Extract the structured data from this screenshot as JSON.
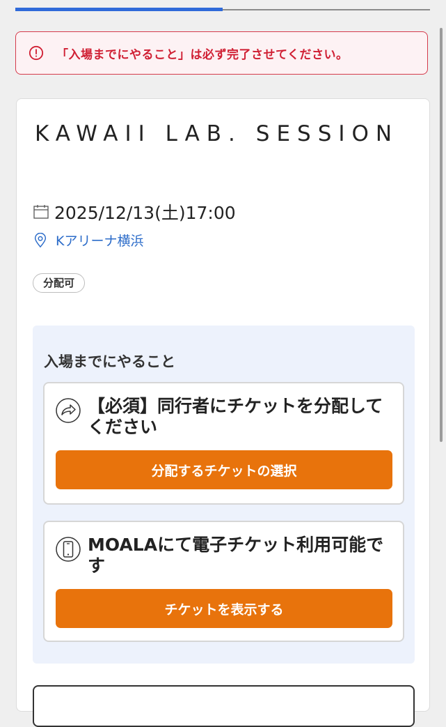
{
  "progress": {
    "fraction": 0.5
  },
  "alert": {
    "text": "「入場までにやること」は必ず完了させてください。",
    "icon": "exclamation-circle-icon",
    "color": "#d01f33"
  },
  "event": {
    "title": "KAWAII LAB. SESSION",
    "date": "2025/12/13(土)17:00",
    "venue": "Kアリーナ横浜",
    "badge": "分配可"
  },
  "todo": {
    "heading": "入場までにやること",
    "tasks": [
      {
        "icon": "share-arrow-icon",
        "text": "【必須】同行者にチケットを分配してください",
        "button": "分配するチケットの選択"
      },
      {
        "icon": "smartphone-icon",
        "text": "MOALAにて電子チケット利用可能です",
        "button": "チケットを表示する"
      }
    ]
  },
  "colors": {
    "accent": "#e8730c",
    "link": "#2c6cc9",
    "progress": "#2f6ad9",
    "panel": "#edf2fc"
  }
}
